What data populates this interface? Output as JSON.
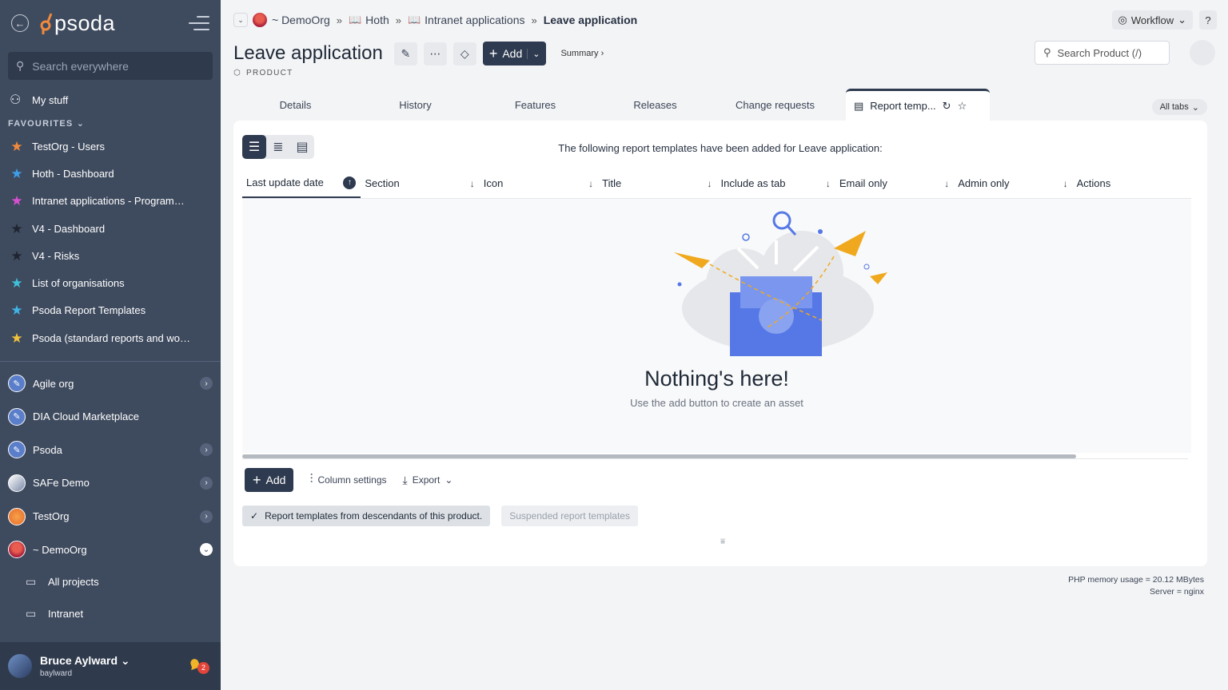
{
  "sidebar": {
    "logo_text": "psoda",
    "search_placeholder": "Search everywhere",
    "my_stuff": "My stuff",
    "favourites_heading": "FAVOURITES",
    "favourites": [
      {
        "label": "TestOrg - Users",
        "color": "#f08a3c"
      },
      {
        "label": "Hoth - Dashboard",
        "color": "#3f9ee8"
      },
      {
        "label": "Intranet applications - Programme...",
        "color": "#d94fd1"
      },
      {
        "label": "V4 - Dashboard",
        "color": "#1f2530"
      },
      {
        "label": "V4 - Risks",
        "color": "#1f2530"
      },
      {
        "label": "List of organisations",
        "color": "#3fc0d8"
      },
      {
        "label": "Psoda Report Templates",
        "color": "#3fb4e6"
      },
      {
        "label": "Psoda (standard reports and work...",
        "color": "#f0c23c"
      }
    ],
    "orgs": [
      {
        "label": "Agile org",
        "expandable": true
      },
      {
        "label": "DIA Cloud Marketplace",
        "expandable": false
      },
      {
        "label": "Psoda",
        "expandable": true
      },
      {
        "label": "SAFe Demo",
        "expandable": true
      },
      {
        "label": "TestOrg",
        "expandable": true
      },
      {
        "label": "~ DemoOrg",
        "expandable": true
      }
    ],
    "sub_items": [
      "All projects",
      "Intranet"
    ],
    "user": {
      "name": "Bruce Aylward",
      "handle": "baylward",
      "notifications": "2"
    }
  },
  "breadcrumb": {
    "items": [
      "~ DemoOrg",
      "Hoth",
      "Intranet applications"
    ],
    "current": "Leave application"
  },
  "top_right": {
    "workflow": "Workflow",
    "help": "?"
  },
  "header": {
    "title": "Leave application",
    "type_label": "PRODUCT",
    "add_label": "Add",
    "summary_link": "Summary ›",
    "search_placeholder": "Search Product (/)"
  },
  "tabs": [
    "Details",
    "History",
    "Features",
    "Releases",
    "Change requests"
  ],
  "active_tab": "Report temp...",
  "all_tabs": "All tabs",
  "panel": {
    "intro": "The following report templates have been added for Leave application:",
    "columns": [
      "Last update date",
      "Section",
      "Icon",
      "Title",
      "Include as tab",
      "Email only",
      "Admin only",
      "Actions"
    ],
    "empty_title": "Nothing's here!",
    "empty_sub": "Use the add button to create an asset",
    "add_label": "Add",
    "column_settings": "Column settings",
    "export": "Export",
    "chip_on": "Report templates from descendants of this product.",
    "chip_off": "Suspended report templates"
  },
  "server_info": {
    "memory": "PHP memory usage = 20.12 MBytes",
    "server": "Server = nginx"
  }
}
